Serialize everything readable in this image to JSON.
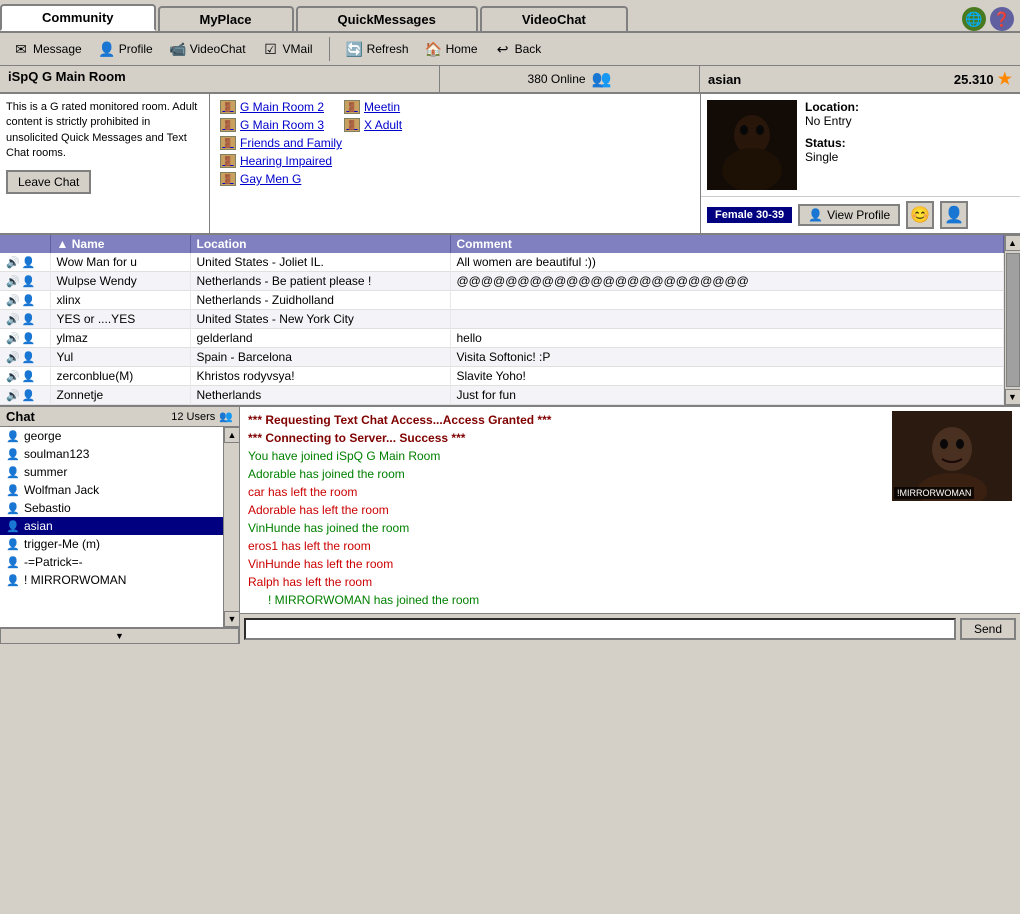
{
  "tabs": {
    "items": [
      {
        "label": "Community",
        "active": true
      },
      {
        "label": "MyPlace",
        "active": false
      },
      {
        "label": "QuickMessages",
        "active": false
      },
      {
        "label": "VideoChat",
        "active": false
      }
    ]
  },
  "toolbar": {
    "buttons": [
      {
        "label": "Message",
        "icon": "✉"
      },
      {
        "label": "Profile",
        "icon": "👤"
      },
      {
        "label": "VideoChat",
        "icon": "📹"
      },
      {
        "label": "VMail",
        "icon": "📬"
      },
      {
        "label": "Refresh",
        "icon": "🔄"
      },
      {
        "label": "Home",
        "icon": "🏠"
      },
      {
        "label": "Back",
        "icon": "←"
      }
    ]
  },
  "room": {
    "name": "iSpQ G Main Room",
    "online_count": "380 Online",
    "description": "This is a G rated monitored room. Adult content is strictly prohibited in unsolicited Quick Messages and Text Chat rooms.",
    "leave_btn": "Leave Chat",
    "links": [
      {
        "label": "G Main Room 2"
      },
      {
        "label": "Meetin"
      },
      {
        "label": "G Main Room 3"
      },
      {
        "label": "X Adult"
      },
      {
        "label": "Friends and Family"
      },
      {
        "label": "Hearing Impaired"
      },
      {
        "label": "Gay Men G"
      }
    ]
  },
  "profile": {
    "name": "asian",
    "score": "25.310",
    "location_label": "Location:",
    "location_value": "No Entry",
    "status_label": "Status:",
    "status_value": "Single",
    "gender_age": "Female  30-39",
    "view_profile_btn": "View Profile"
  },
  "user_table": {
    "headers": [
      "",
      "Name",
      "Location",
      "Comment"
    ],
    "rows": [
      {
        "name": "Wow Man for u",
        "location": "United States - Joliet IL.",
        "comment": "All women are beautiful :))"
      },
      {
        "name": "Wulpse Wendy",
        "location": "Netherlands - Be patient please !",
        "comment": "@@@@@@@@@@@@@@@@@@@@@@@@"
      },
      {
        "name": "xlinx",
        "location": "Netherlands - Zuidholland",
        "comment": ""
      },
      {
        "name": "YES or ....YES",
        "location": "United States - New York City",
        "comment": ""
      },
      {
        "name": "ylmaz",
        "location": "gelderland",
        "comment": "hello"
      },
      {
        "name": "Yul",
        "location": "Spain - Barcelona",
        "comment": "Visita Softonic! :P"
      },
      {
        "name": "zerconblue(M)",
        "location": "Khristos rodyvsya!",
        "comment": "Slavite Yoho!"
      },
      {
        "name": "Zonnetje",
        "location": "Netherlands",
        "comment": "Just for fun"
      }
    ]
  },
  "chat": {
    "title": "Chat",
    "user_count": "12 Users",
    "users": [
      {
        "name": "george",
        "selected": false
      },
      {
        "name": "soulman123",
        "selected": false
      },
      {
        "name": "summer",
        "selected": false
      },
      {
        "name": "Wolfman Jack",
        "selected": false
      },
      {
        "name": "Sebastio",
        "selected": false
      },
      {
        "name": "asian",
        "selected": true
      },
      {
        "name": "trigger-Me (m)",
        "selected": false
      },
      {
        "name": "-=Patrick=-",
        "selected": false
      },
      {
        "name": "!       MIRRORWOMAN",
        "selected": false
      }
    ],
    "messages": [
      {
        "text": "*** Requesting Text Chat Access...Access Granted ***",
        "type": "system"
      },
      {
        "text": "*** Connecting to Server... Success ***",
        "type": "system"
      },
      {
        "text": "You have joined iSpQ G Main Room",
        "type": "green"
      },
      {
        "text": "Adorable has joined the room",
        "type": "green"
      },
      {
        "text": "car has left the room",
        "type": "red"
      },
      {
        "text": "Adorable has left the room",
        "type": "red"
      },
      {
        "text": "VinHunde has joined the room",
        "type": "green"
      },
      {
        "text": "eros1 has left the room",
        "type": "red"
      },
      {
        "text": "VinHunde has left the room",
        "type": "red"
      },
      {
        "text": "Ralph has left the room",
        "type": "red"
      },
      {
        "text": "!       MIRRORWOMAN has joined the room",
        "type": "green",
        "indent": true
      }
    ],
    "video_label": "!MIRRORWOMAN",
    "send_btn": "Send",
    "input_placeholder": ""
  }
}
